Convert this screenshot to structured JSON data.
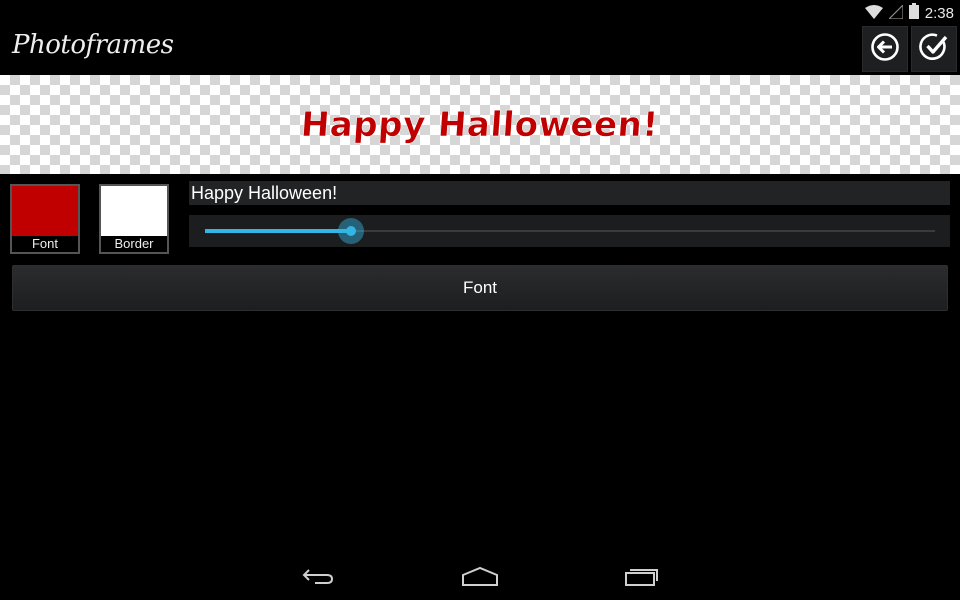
{
  "status_bar": {
    "time": "2:38"
  },
  "app": {
    "title": "Photoframes"
  },
  "preview": {
    "text": "Happy Halloween!",
    "text_color": "#c00000"
  },
  "swatches": [
    {
      "label": "Font",
      "color": "#c00000"
    },
    {
      "label": "Border",
      "color": "#ffffff"
    }
  ],
  "text_input": {
    "value": "Happy Halloween!"
  },
  "slider": {
    "value_fraction": 0.2
  },
  "font_button": {
    "label": "Font"
  },
  "colors": {
    "accent": "#33b5e5",
    "background": "#000000"
  },
  "icons": [
    "wifi-icon",
    "signal-icon",
    "battery-icon",
    "back-arrow-icon",
    "check-icon",
    "nav-back-icon",
    "nav-home-icon",
    "nav-recents-icon"
  ]
}
